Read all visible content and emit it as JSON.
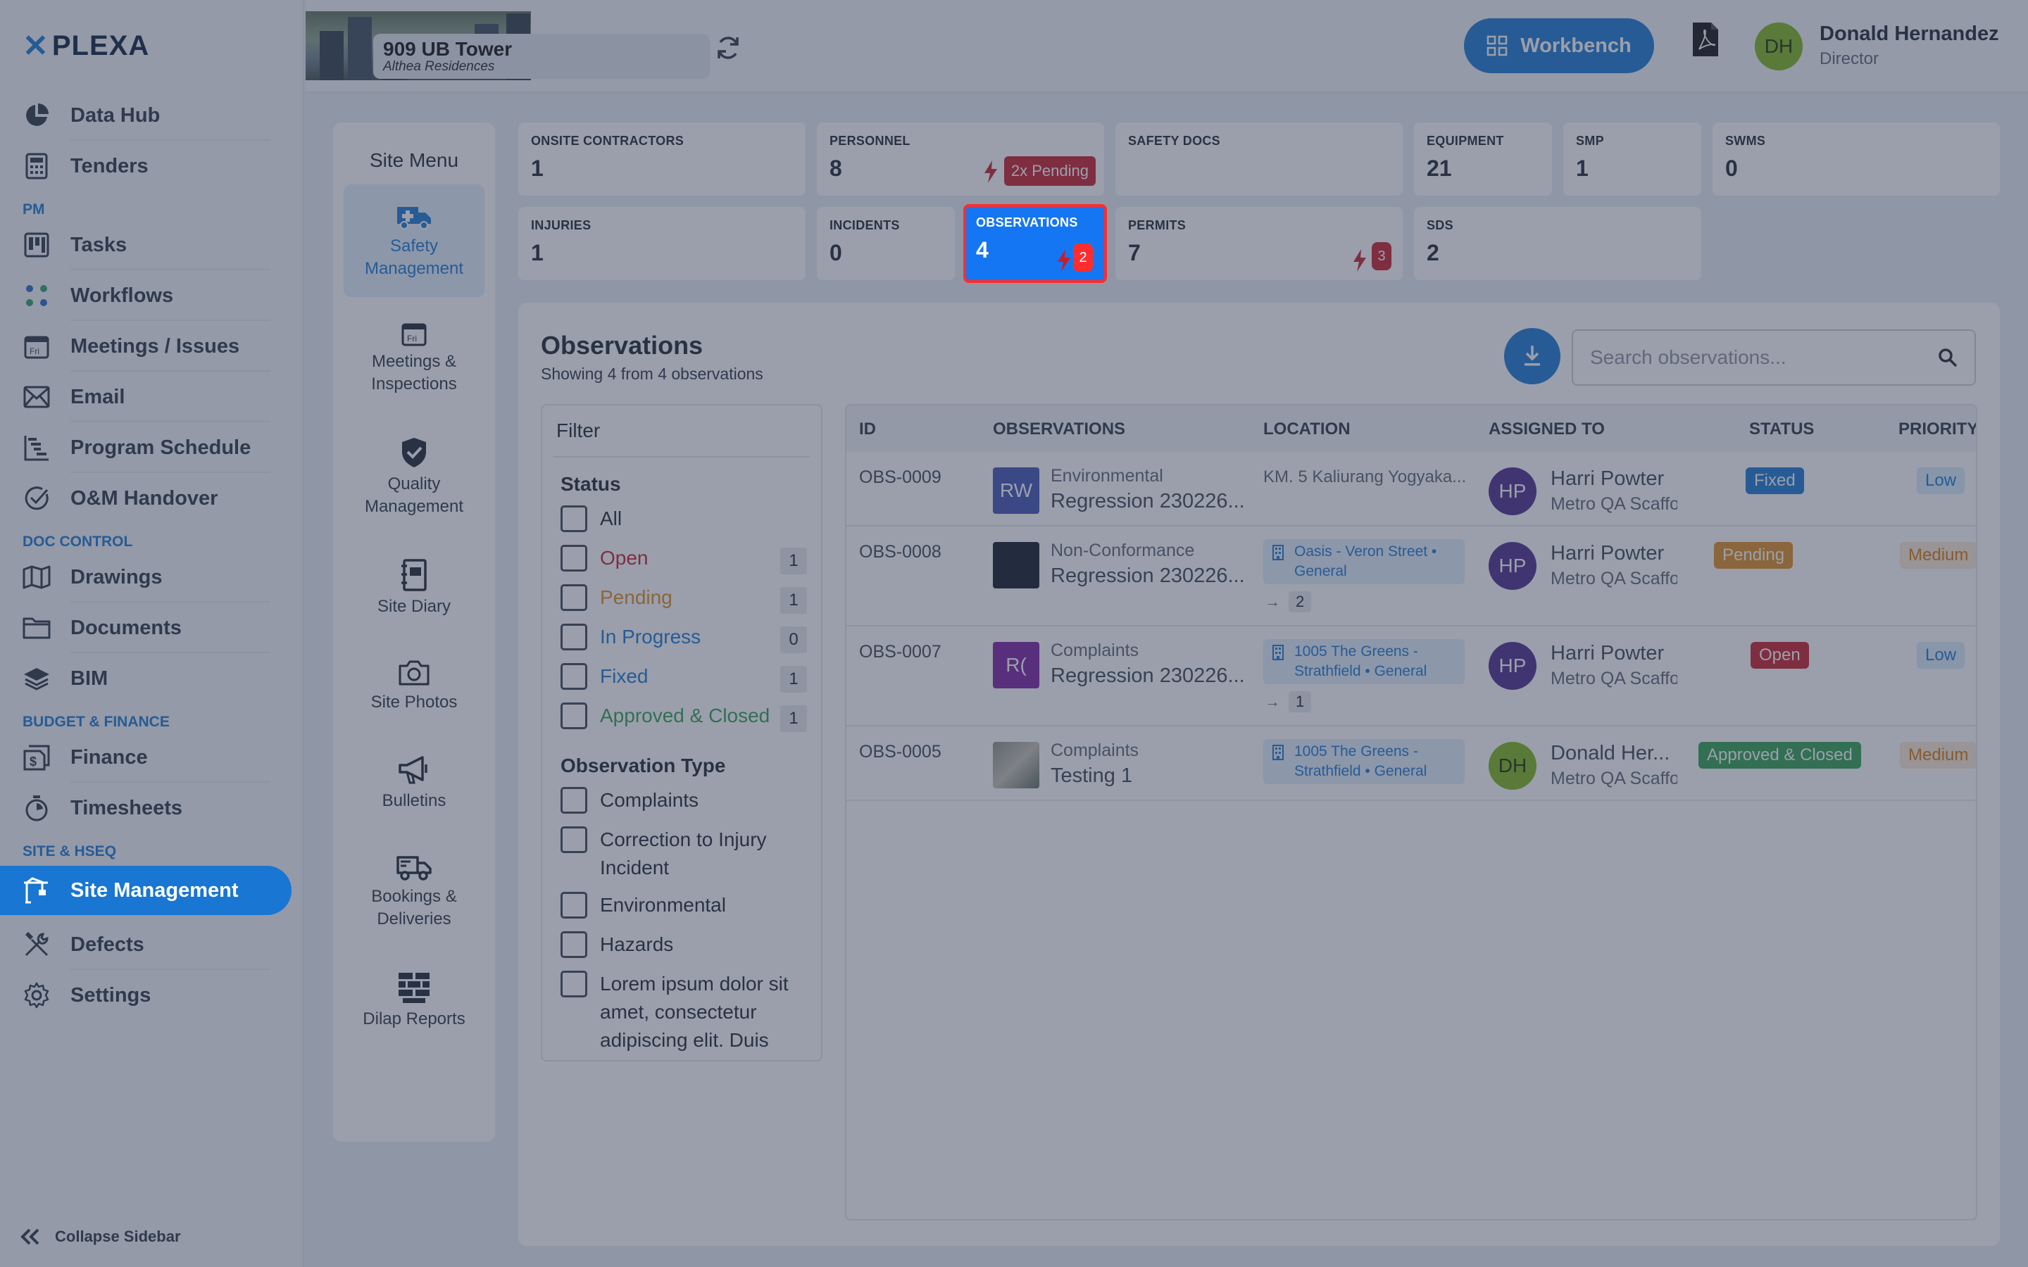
{
  "brand": {
    "logo_mark": "✕",
    "logo_text": "PLEXA"
  },
  "sidebar": {
    "items": [
      {
        "label": "Data Hub",
        "icon": "pie-chart-icon"
      },
      {
        "label": "Tenders",
        "icon": "calculator-icon"
      },
      {
        "section": "PM"
      },
      {
        "label": "Tasks",
        "icon": "kanban-icon"
      },
      {
        "label": "Workflows",
        "icon": "workflow-icon"
      },
      {
        "label": "Meetings / Issues",
        "icon": "calendar-icon"
      },
      {
        "label": "Email",
        "icon": "email-icon"
      },
      {
        "label": "Program Schedule",
        "icon": "gantt-icon"
      },
      {
        "label": "O&M Handover",
        "icon": "check-circle-icon"
      },
      {
        "section": "DOC CONTROL"
      },
      {
        "label": "Drawings",
        "icon": "map-icon"
      },
      {
        "label": "Documents",
        "icon": "folder-icon"
      },
      {
        "label": "BIM",
        "icon": "layers-icon"
      },
      {
        "section": "BUDGET & FINANCE"
      },
      {
        "label": "Finance",
        "icon": "finance-icon"
      },
      {
        "label": "Timesheets",
        "icon": "stopwatch-icon"
      },
      {
        "section": "SITE & HSEQ"
      },
      {
        "label": "Site Management",
        "icon": "crane-icon",
        "active": true
      },
      {
        "label": "Defects",
        "icon": "tools-icon"
      },
      {
        "label": "Settings",
        "icon": "gear-icon"
      }
    ],
    "collapse_label": "Collapse Sidebar"
  },
  "topbar": {
    "project_name": "909 UB Tower",
    "project_sub": "Althea Residences",
    "workbench_label": "Workbench",
    "user": {
      "initials": "DH",
      "name": "Donald Hernandez",
      "role": "Director"
    }
  },
  "site_menu": {
    "title": "Site Menu",
    "items": [
      {
        "label": "Safety Management",
        "icon": "ambulance-icon",
        "active": true
      },
      {
        "label": "Meetings & Inspections",
        "icon": "calendar-icon"
      },
      {
        "label": "Quality Management",
        "icon": "shield-check-icon"
      },
      {
        "label": "Site Diary",
        "icon": "diary-icon"
      },
      {
        "label": "Site Photos",
        "icon": "camera-icon"
      },
      {
        "label": "Bulletins",
        "icon": "megaphone-icon"
      },
      {
        "label": "Bookings & Deliveries",
        "icon": "truck-icon"
      },
      {
        "label": "Dilap Reports",
        "icon": "brick-wall-icon"
      }
    ]
  },
  "stats": {
    "onsite_contractors": {
      "label": "ONSITE CONTRACTORS",
      "value": "1"
    },
    "personnel": {
      "label": "PERSONNEL",
      "value": "8",
      "badge": "2x Pending"
    },
    "safety_docs": {
      "label": "SAFETY DOCS",
      "value": ""
    },
    "equipment": {
      "label": "EQUIPMENT",
      "value": "21"
    },
    "smp": {
      "label": "SMP",
      "value": "1"
    },
    "swms": {
      "label": "SWMS",
      "value": "0"
    },
    "injuries": {
      "label": "INJURIES",
      "value": "1"
    },
    "incidents": {
      "label": "INCIDENTS",
      "value": "0"
    },
    "observations": {
      "label": "OBSERVATIONS",
      "value": "4",
      "badge": "2"
    },
    "permits": {
      "label": "PERMITS",
      "value": "7",
      "badge": "3"
    },
    "sds": {
      "label": "SDS",
      "value": "2"
    }
  },
  "panel": {
    "title": "Observations",
    "subtitle": "Showing 4 from 4 observations",
    "search_placeholder": "Search observations..."
  },
  "filter": {
    "title": "Filter",
    "status_title": "Status",
    "status": [
      {
        "label": "All",
        "count": "",
        "color": "#1c2430"
      },
      {
        "label": "Open",
        "count": "1",
        "color": "#c91d2a"
      },
      {
        "label": "Pending",
        "count": "1",
        "color": "#e08a1e"
      },
      {
        "label": "In Progress",
        "count": "0",
        "color": "#1976d2"
      },
      {
        "label": "Fixed",
        "count": "1",
        "color": "#1976d2"
      },
      {
        "label": "Approved & Closed",
        "count": "1",
        "color": "#2e9e4f"
      }
    ],
    "type_title": "Observation Type",
    "types": [
      "Complaints",
      "Correction to Injury Incident",
      "Environmental",
      "Hazards",
      "Lorem ipsum dolor sit amet, consectetur adipiscing elit. Duis"
    ]
  },
  "table": {
    "headers": {
      "id": "ID",
      "observations": "OBSERVATIONS",
      "location": "LOCATION",
      "assigned": "ASSIGNED TO",
      "status": "STATUS",
      "priority": "PRIORITY"
    },
    "rows": [
      {
        "id": "OBS-0009",
        "thumb": "RW",
        "thumb_color": "#3f51b5",
        "type": "Environmental",
        "title": "Regression 230226...",
        "location": "KM. 5 Kaliurang Yogyaka...",
        "location_chip": false,
        "location_more": "",
        "initials": "HP",
        "avatar_color": "#4a2a8a",
        "assignee": "Harri Powter",
        "org": "Metro QA Scaffo",
        "status": "Fixed",
        "status_color": "#1976d2",
        "priority": "Low",
        "priority_bg": "#d9ecfb",
        "priority_fg": "#1976d2"
      },
      {
        "id": "OBS-0008",
        "thumb": "",
        "thumb_color": "#111827",
        "type": "Non-Conformance",
        "title": "Regression 230226...",
        "location": "Oasis - Veron Street • General",
        "location_chip": true,
        "location_more": "2",
        "initials": "HP",
        "avatar_color": "#4a2a8a",
        "assignee": "Harri Powter",
        "org": "Metro QA Scaffo",
        "status": "Pending",
        "status_color": "#e08a1e",
        "priority": "Medium",
        "priority_bg": "#fde9d2",
        "priority_fg": "#d97706"
      },
      {
        "id": "OBS-0007",
        "thumb": "R(",
        "thumb_color": "#7b1fa2",
        "type": "Complaints",
        "title": "Regression 230226...",
        "location": "1005 The Greens - Strathfield • General",
        "location_chip": true,
        "location_more": "1",
        "initials": "HP",
        "avatar_color": "#4a2a8a",
        "assignee": "Harri Powter",
        "org": "Metro QA Scaffo",
        "status": "Open",
        "status_color": "#c91d2a",
        "priority": "Low",
        "priority_bg": "#d9ecfb",
        "priority_fg": "#1976d2"
      },
      {
        "id": "OBS-0005",
        "thumb": "",
        "thumb_color": "photo",
        "type": "Complaints",
        "title": "Testing 1",
        "location": "1005 The Greens - Strathfield • General",
        "location_chip": true,
        "location_more": "",
        "initials": "DH",
        "avatar_color": "#7cb518",
        "assignee": "Donald Her...",
        "org": "Metro QA Scaffo",
        "status": "Approved & Closed",
        "status_color": "#2e9e4f",
        "priority": "Medium",
        "priority_bg": "#fde9d2",
        "priority_fg": "#d97706"
      }
    ]
  }
}
